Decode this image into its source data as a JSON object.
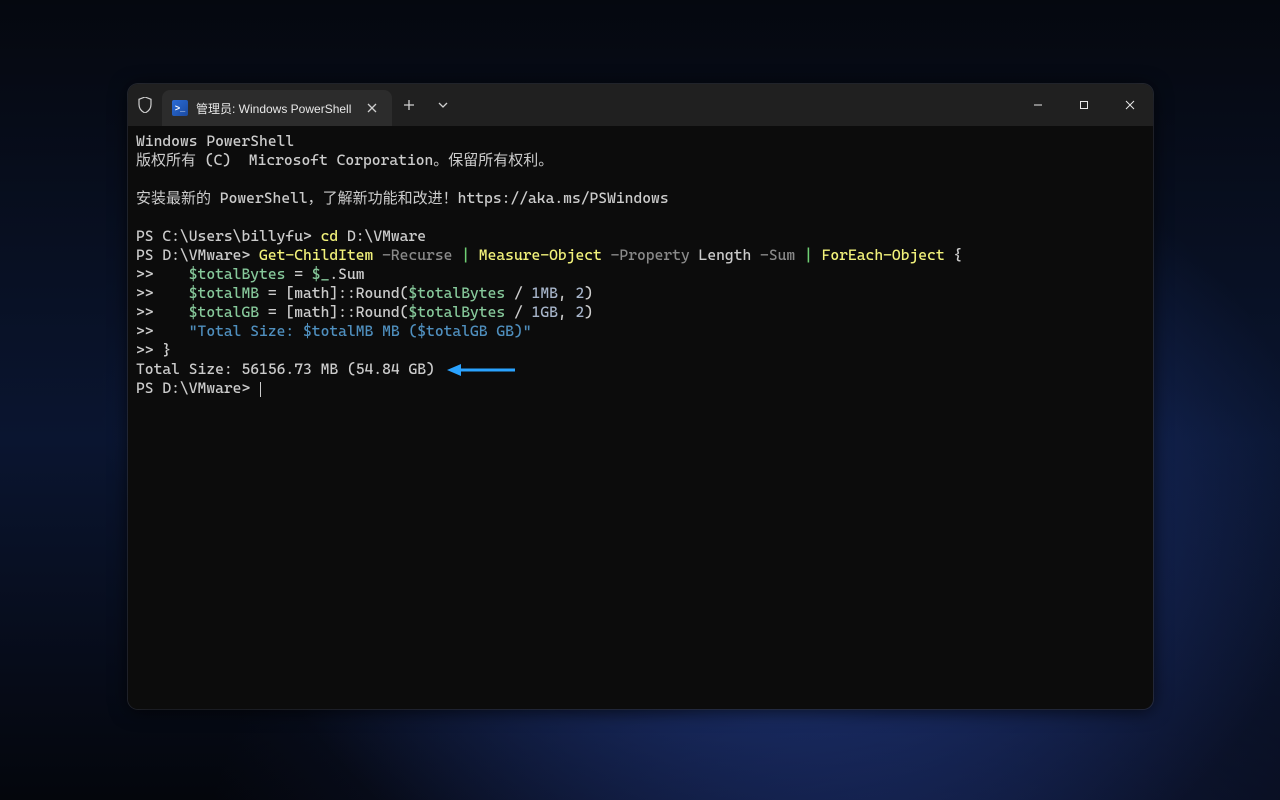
{
  "titlebar": {
    "tab_title": "管理员: Windows PowerShell"
  },
  "terminal": {
    "line1": "Windows PowerShell",
    "line2": "版权所有 (C)  Microsoft Corporation。保留所有权利。",
    "line3": "安装最新的 PowerShell，了解新功能和改进！https://aka.ms/PSWindows",
    "prompt1_prefix": "PS C:\\Users\\billyfu> ",
    "prompt1_cmd": "cd",
    "prompt1_arg": " D:\\VMware",
    "prompt2_prefix": "PS D:\\VMware> ",
    "prompt2_cmd1": "Get-ChildItem",
    "prompt2_p1": " -Recurse ",
    "pipe": "|",
    "prompt2_cmd2": " Measure-Object",
    "prompt2_p2": " -Property ",
    "prompt2_arg2": "Length",
    "prompt2_p3": " -Sum ",
    "prompt2_cmd3": " ForEach-Object",
    "prompt2_brace": " {",
    "cont": ">>",
    "cont_indent": "    ",
    "lineA_var1": "$totalBytes",
    "lineA_eq": " = ",
    "lineA_var2": "$_",
    "lineA_dot": ".Sum",
    "lineB_var1": "$totalMB",
    "lineB_eq": " = [math]::Round(",
    "lineB_var2": "$totalBytes",
    "lineB_mid": " / ",
    "lineB_unit": "1MB",
    "lineB_tail": ", ",
    "lineB_num": "2",
    "lineB_close": ")",
    "lineC_var1": "$totalGB",
    "lineC_eq": " = [math]::Round(",
    "lineC_var2": "$totalBytes",
    "lineC_mid": " / ",
    "lineC_unit": "1GB",
    "lineC_tail": ", ",
    "lineC_num": "2",
    "lineC_close": ")",
    "lineD_str_open": "\"Total Size: ",
    "lineD_v1": "$totalMB",
    "lineD_mid": " MB (",
    "lineD_v2": "$totalGB",
    "lineD_close": " GB)\"",
    "lineE_brace": "}",
    "output": "Total Size: 56156.73 MB (54.84 GB)",
    "prompt3_prefix": "PS D:\\VMware> "
  },
  "colors": {
    "arrow": "#2aa3ff"
  }
}
